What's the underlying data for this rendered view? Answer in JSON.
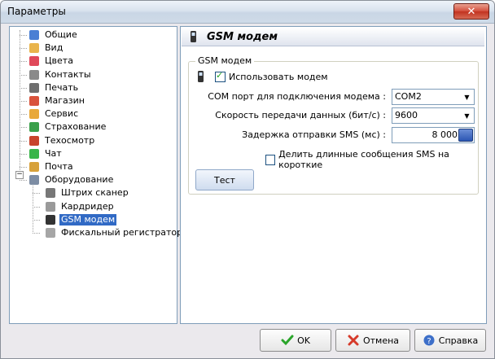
{
  "window": {
    "title": "Параметры"
  },
  "tree": {
    "items": [
      {
        "label": "Общие",
        "icon": "general-icon"
      },
      {
        "label": "Вид",
        "icon": "view-icon"
      },
      {
        "label": "Цвета",
        "icon": "colors-icon"
      },
      {
        "label": "Контакты",
        "icon": "contacts-icon"
      },
      {
        "label": "Печать",
        "icon": "printer-icon"
      },
      {
        "label": "Магазин",
        "icon": "store-icon"
      },
      {
        "label": "Сервис",
        "icon": "service-icon"
      },
      {
        "label": "Страхование",
        "icon": "insurance-icon"
      },
      {
        "label": "Техосмотр",
        "icon": "inspection-icon"
      },
      {
        "label": "Чат",
        "icon": "chat-icon"
      },
      {
        "label": "Почта",
        "icon": "mail-icon"
      },
      {
        "label": "Оборудование",
        "icon": "equipment-icon",
        "expanded": true
      },
      {
        "label": "Штрих сканер",
        "icon": "barcode-scanner-icon",
        "child": true
      },
      {
        "label": "Кардридер",
        "icon": "card-reader-icon",
        "child": true
      },
      {
        "label": "GSM модем",
        "icon": "mobile-phone-icon",
        "child": true,
        "selected": true
      },
      {
        "label": "Фискальный регистратор",
        "icon": "fiscal-register-icon",
        "child": true
      }
    ]
  },
  "panel": {
    "header_title": "GSM модем",
    "group_title": "GSM модем",
    "use_modem_label": "Использовать модем",
    "use_modem_checked": true,
    "com_port_label": "COM порт для подключения модема :",
    "com_port_value": "COM2",
    "speed_label": "Скорость передачи данных (бит/с) :",
    "speed_value": "9600",
    "delay_label": "Задержка отправки SMS (мс) :",
    "delay_value": "8 000",
    "split_label": "Делить длинные сообщения SMS на короткие",
    "split_checked": false,
    "test_button": "Тест"
  },
  "buttons": {
    "ok": "OK",
    "cancel": "Отмена",
    "help": "Справка"
  }
}
